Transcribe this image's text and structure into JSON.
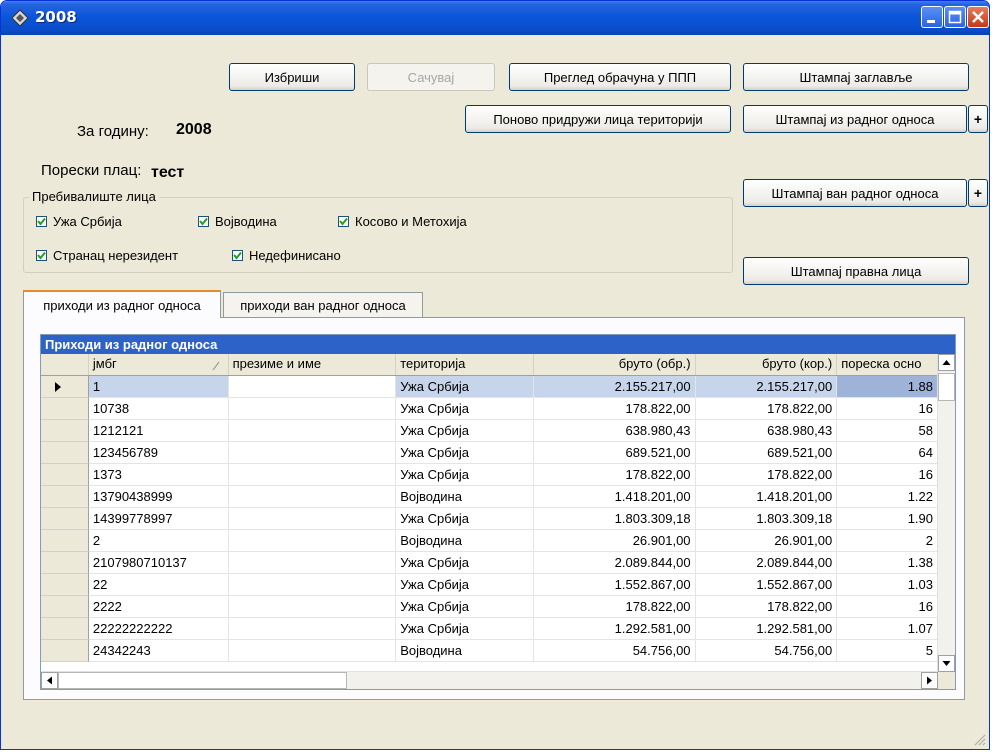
{
  "window": {
    "title": "2008"
  },
  "toolbar": {
    "delete_label": "Избриши",
    "save_label": "Сачувај",
    "preview_label": "Преглед обрачуна у ППП",
    "print_header_label": "Штампај заглавље",
    "reassign_label": "Поново придружи лица територији",
    "print_employment_label": "Штампај из радног односа",
    "print_non_employment_label": "Штампај ван радног односа",
    "print_legal_label": "Штампај правна лица",
    "plus_label": "+"
  },
  "info": {
    "year_label": "За годину:",
    "year_value": "2008",
    "taxpayer_label": "Порески плац:",
    "taxpayer_value": "тест"
  },
  "residence": {
    "title": "Пребивалиште лица",
    "options": [
      {
        "label": "Ужа Србија",
        "checked": true
      },
      {
        "label": "Војводина",
        "checked": true
      },
      {
        "label": "Косово и Метохија",
        "checked": true
      },
      {
        "label": "Странац нерезидент",
        "checked": true
      },
      {
        "label": "Недефинисано",
        "checked": true
      }
    ]
  },
  "tabs": [
    {
      "label": "приходи из радног односа",
      "active": true
    },
    {
      "label": "приходи ван радног односа",
      "active": false
    }
  ],
  "grid": {
    "caption": "Приходи из радног односа",
    "columns": [
      "јмбг",
      "презиме и име",
      "територија",
      "бруто (обр.)",
      "бруто (кор.)",
      "пореска осно"
    ],
    "rows": [
      {
        "jmbg": "1",
        "territory": "Ужа Србија",
        "gross_calc": "2.155.217,00",
        "gross_corr": "2.155.217,00",
        "tax_base": "1.88"
      },
      {
        "jmbg": "10738",
        "territory": "Ужа Србија",
        "gross_calc": "178.822,00",
        "gross_corr": "178.822,00",
        "tax_base": "16"
      },
      {
        "jmbg": "1212121",
        "territory": "Ужа Србија",
        "gross_calc": "638.980,43",
        "gross_corr": "638.980,43",
        "tax_base": "58"
      },
      {
        "jmbg": "123456789",
        "territory": "Ужа Србија",
        "gross_calc": "689.521,00",
        "gross_corr": "689.521,00",
        "tax_base": "64"
      },
      {
        "jmbg": "1373",
        "territory": "Ужа Србија",
        "gross_calc": "178.822,00",
        "gross_corr": "178.822,00",
        "tax_base": "16"
      },
      {
        "jmbg": "13790438999",
        "territory": "Војводина",
        "gross_calc": "1.418.201,00",
        "gross_corr": "1.418.201,00",
        "tax_base": "1.22"
      },
      {
        "jmbg": "14399778997",
        "territory": "Ужа Србија",
        "gross_calc": "1.803.309,18",
        "gross_corr": "1.803.309,18",
        "tax_base": "1.90"
      },
      {
        "jmbg": "2",
        "territory": "Војводина",
        "gross_calc": "26.901,00",
        "gross_corr": "26.901,00",
        "tax_base": "2"
      },
      {
        "jmbg": "2107980710137",
        "territory": "Ужа Србија",
        "gross_calc": "2.089.844,00",
        "gross_corr": "2.089.844,00",
        "tax_base": "1.38"
      },
      {
        "jmbg": "22",
        "territory": "Ужа Србија",
        "gross_calc": "1.552.867,00",
        "gross_corr": "1.552.867,00",
        "tax_base": "1.03"
      },
      {
        "jmbg": "2222",
        "territory": "Ужа Србија",
        "gross_calc": "178.822,00",
        "gross_corr": "178.822,00",
        "tax_base": "16"
      },
      {
        "jmbg": "22222222222",
        "territory": "Ужа Србија",
        "gross_calc": "1.292.581,00",
        "gross_corr": "1.292.581,00",
        "tax_base": "1.07"
      },
      {
        "jmbg": "24342243",
        "territory": "Војводина",
        "gross_calc": "54.756,00",
        "gross_corr": "54.756,00",
        "tax_base": "5"
      }
    ]
  },
  "icons": {
    "app": "diamond-app-icon",
    "minimize": "minimize-icon",
    "maximize": "maximize-icon",
    "close": "close-icon",
    "row_pointer": "row-pointer-icon",
    "sort": "sort-icon"
  },
  "colors": {
    "titlebar": "#0a55d8",
    "grid_caption": "#2d62c9",
    "selection": "#c7d5ea",
    "close_button": "#c33a12"
  }
}
